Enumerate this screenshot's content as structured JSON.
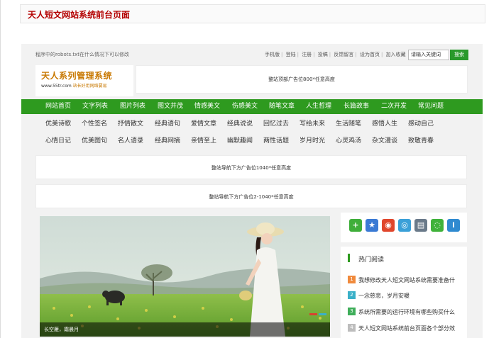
{
  "page_title": "天人短文网站系统前台页面",
  "topbar": {
    "robots_text": "程序中的robots.txt在什么情况下可以修改",
    "links": [
      "手机版",
      "登陆",
      "注册",
      "投稿",
      "反馈留言",
      "设为首页",
      "加入收藏"
    ],
    "search_placeholder": "请输入关键词",
    "search_button": "搜索"
  },
  "logo": {
    "name": "天人系列管理系统",
    "url": "www.55tr.com",
    "slogan": "站长好用网络要易"
  },
  "ads": {
    "top": "整站顶部广告位800*任意高度",
    "nav_below_1": "整站导航下方广告位1040*任意高度",
    "nav_below_2": "整站导航下方广告位2-1040*任意高度"
  },
  "nav": [
    "网站首页",
    "文字列表",
    "图片列表",
    "图文并茂",
    "情感美文",
    "伤感美文",
    "随笔文章",
    "人生哲理",
    "长篇故事",
    "二次开发",
    "常见问题"
  ],
  "subnav_row1": [
    "优美诗歌",
    "个性签名",
    "抒情散文",
    "经典语句",
    "爱情文章",
    "经典说说",
    "回忆过去",
    "写给未来",
    "生活随笔",
    "感悟人生",
    "感动自己"
  ],
  "subnav_row2": [
    "心情日记",
    "优美图句",
    "名人语录",
    "经典网摘",
    "亲情至上",
    "幽默趣闻",
    "两性话题",
    "岁月时光",
    "心灵鸡汤",
    "杂文漫谈",
    "致敬青春"
  ],
  "slider": {
    "caption": "长空雁，霜晨月"
  },
  "share_icons": [
    "plus-icon",
    "qzone-icon",
    "weibo-icon",
    "tencent-weibo-icon",
    "print-icon",
    "wechat-icon",
    "info-icon"
  ],
  "hot": {
    "title": "热门阅读",
    "items": [
      {
        "num": "1",
        "text": "我想修改天人短文网站系统需要准备什"
      },
      {
        "num": "2",
        "text": "一念慈悲，岁月安暖"
      },
      {
        "num": "3",
        "text": "系统所需要的运行环境有哪些购买什么"
      },
      {
        "num": "4",
        "text": "天人短文网站系统前台页面各个部分效"
      }
    ]
  },
  "colors": {
    "nav_green": "#2e9a1f",
    "title_red": "#b40000",
    "hot_num_1": "#f08a3c",
    "hot_num_2": "#3ab0c8",
    "hot_num_3": "#3fae5a",
    "hot_num_4": "#bdbdbd"
  }
}
